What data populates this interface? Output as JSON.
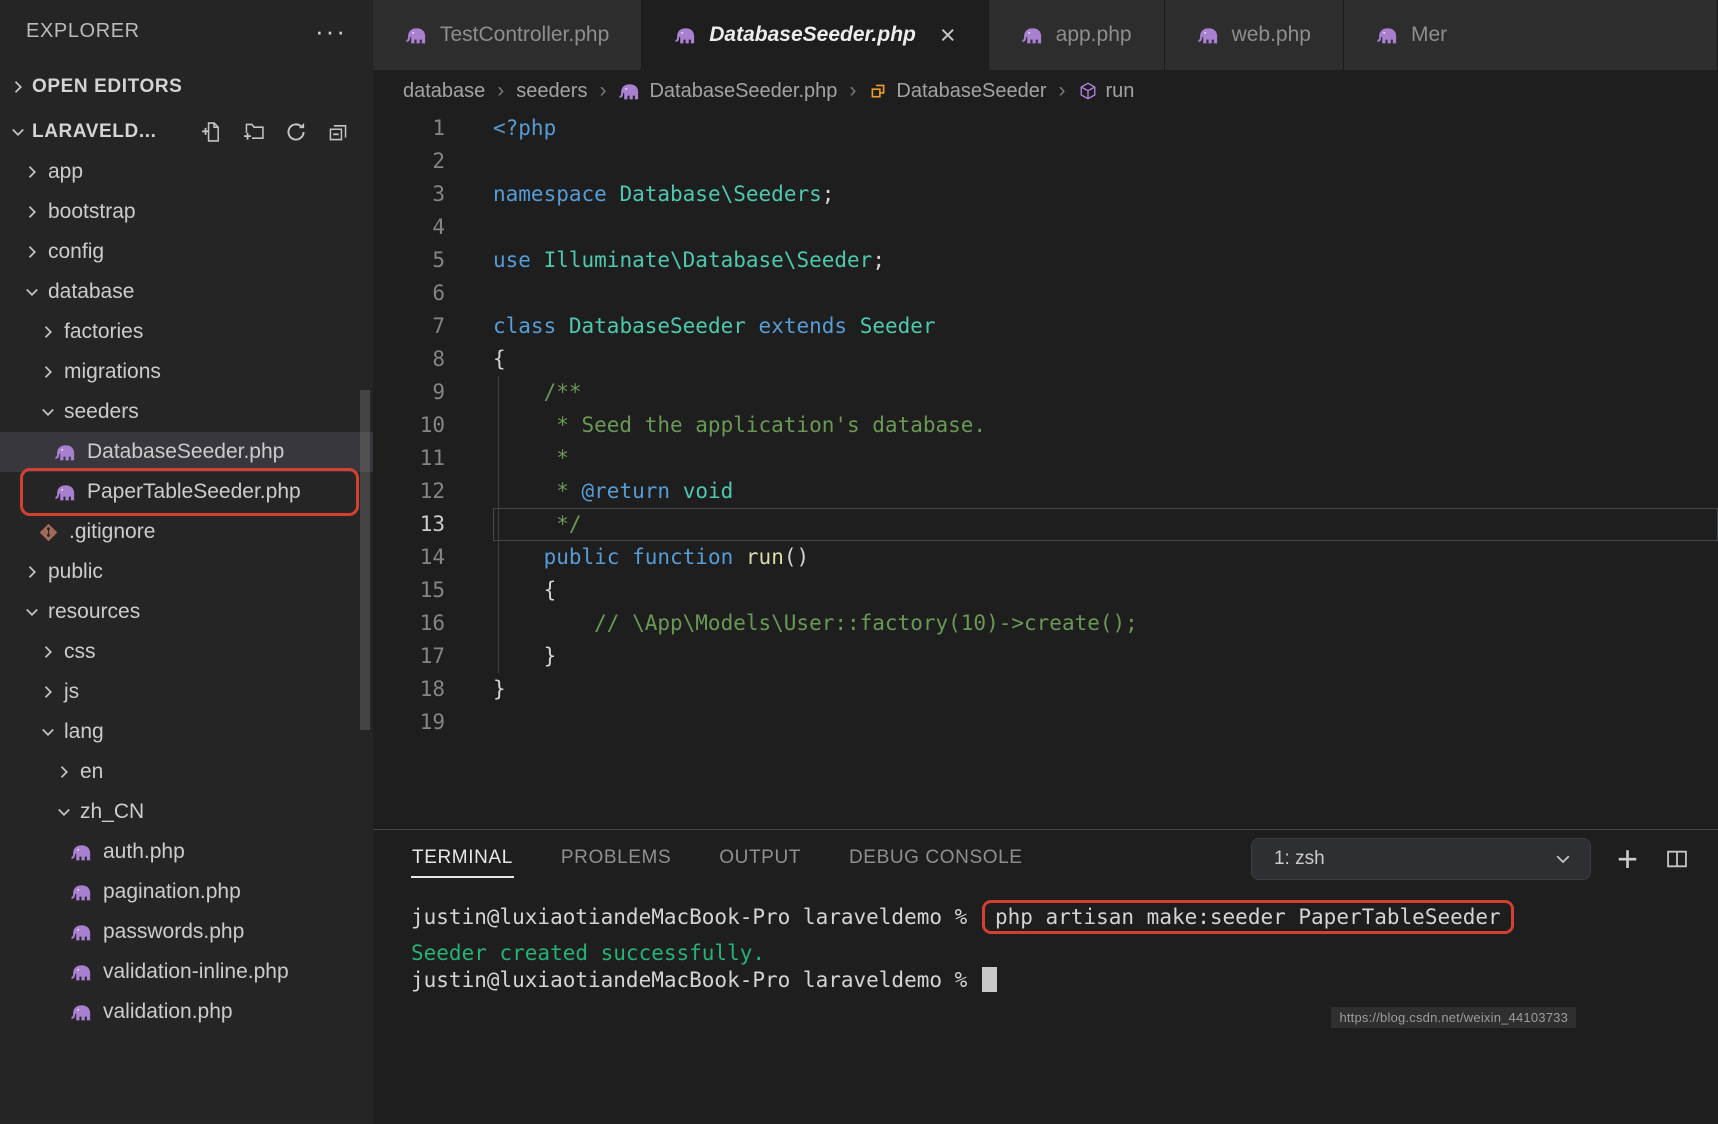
{
  "colors": {
    "annotation_red": "#d3402f",
    "php_icon_purple": "#A97FD0",
    "keyword_blue": "#569cd6",
    "type_teal": "#4ec9b0",
    "comment_green": "#6a9955",
    "function_yellow": "#dcdcaa",
    "terminal_success_green": "#26b277",
    "selection_bg": "#37373d"
  },
  "sidebar": {
    "title": "EXPLORER",
    "more_glyph": "···",
    "open_editors_label": "OPEN EDITORS",
    "workspace_label": "LARAVELD...",
    "workspace_actions": [
      {
        "icon": "new-file-icon"
      },
      {
        "icon": "new-folder-icon"
      },
      {
        "icon": "refresh-icon"
      },
      {
        "icon": "collapse-all-icon"
      }
    ],
    "tree": [
      {
        "label": "app",
        "kind": "folder",
        "expanded": false,
        "indent": 1
      },
      {
        "label": "bootstrap",
        "kind": "folder",
        "expanded": false,
        "indent": 1
      },
      {
        "label": "config",
        "kind": "folder",
        "expanded": false,
        "indent": 1
      },
      {
        "label": "database",
        "kind": "folder",
        "expanded": true,
        "indent": 1
      },
      {
        "label": "factories",
        "kind": "folder",
        "expanded": false,
        "indent": 2
      },
      {
        "label": "migrations",
        "kind": "folder",
        "expanded": false,
        "indent": 2
      },
      {
        "label": "seeders",
        "kind": "folder",
        "expanded": true,
        "indent": 2
      },
      {
        "label": "DatabaseSeeder.php",
        "kind": "php",
        "indent": 3,
        "selected": true
      },
      {
        "label": "PaperTableSeeder.php",
        "kind": "php",
        "indent": 3,
        "annotated": true
      },
      {
        "label": ".gitignore",
        "kind": "git",
        "indent": 2
      },
      {
        "label": "public",
        "kind": "folder",
        "expanded": false,
        "indent": 1
      },
      {
        "label": "resources",
        "kind": "folder",
        "expanded": true,
        "indent": 1
      },
      {
        "label": "css",
        "kind": "folder",
        "expanded": false,
        "indent": 2
      },
      {
        "label": "js",
        "kind": "folder",
        "expanded": false,
        "indent": 2
      },
      {
        "label": "lang",
        "kind": "folder",
        "expanded": true,
        "indent": 2
      },
      {
        "label": "en",
        "kind": "folder",
        "expanded": false,
        "indent": 3
      },
      {
        "label": "zh_CN",
        "kind": "folder",
        "expanded": true,
        "indent": 3
      },
      {
        "label": "auth.php",
        "kind": "php",
        "indent": 4
      },
      {
        "label": "pagination.php",
        "kind": "php",
        "indent": 4
      },
      {
        "label": "passwords.php",
        "kind": "php",
        "indent": 4
      },
      {
        "label": "validation-inline.php",
        "kind": "php",
        "indent": 4
      },
      {
        "label": "validation.php",
        "kind": "php",
        "indent": 4
      }
    ]
  },
  "tabs": [
    {
      "label": "TestController.php",
      "active": false
    },
    {
      "label": "DatabaseSeeder.php",
      "active": true
    },
    {
      "label": "app.php",
      "active": false
    },
    {
      "label": "web.php",
      "active": false
    },
    {
      "label": "Mer",
      "active": false
    }
  ],
  "breadcrumb": [
    {
      "label": "database"
    },
    {
      "label": "seeders"
    },
    {
      "label": "DatabaseSeeder.php",
      "icon": "php-file-icon"
    },
    {
      "label": "DatabaseSeeder",
      "icon": "class-icon"
    },
    {
      "label": "run",
      "icon": "method-icon"
    }
  ],
  "editor": {
    "lines": [
      {
        "n": 1,
        "tokens": [
          {
            "c": "kw",
            "t": "<?php"
          }
        ]
      },
      {
        "n": 2,
        "tokens": []
      },
      {
        "n": 3,
        "tokens": [
          {
            "c": "kw",
            "t": "namespace"
          },
          {
            "c": "pl",
            "t": " "
          },
          {
            "c": "type",
            "t": "Database\\Seeders"
          },
          {
            "c": "pl",
            "t": ";"
          }
        ]
      },
      {
        "n": 4,
        "tokens": []
      },
      {
        "n": 5,
        "tokens": [
          {
            "c": "kw",
            "t": "use"
          },
          {
            "c": "pl",
            "t": " "
          },
          {
            "c": "type",
            "t": "Illuminate\\Database\\Seeder"
          },
          {
            "c": "pl",
            "t": ";"
          }
        ]
      },
      {
        "n": 6,
        "tokens": []
      },
      {
        "n": 7,
        "tokens": [
          {
            "c": "kw",
            "t": "class"
          },
          {
            "c": "pl",
            "t": " "
          },
          {
            "c": "type",
            "t": "DatabaseSeeder"
          },
          {
            "c": "pl",
            "t": " "
          },
          {
            "c": "kw",
            "t": "extends"
          },
          {
            "c": "pl",
            "t": " "
          },
          {
            "c": "type",
            "t": "Seeder"
          }
        ]
      },
      {
        "n": 8,
        "tokens": [
          {
            "c": "pl",
            "t": "{"
          }
        ]
      },
      {
        "n": 9,
        "tokens": [
          {
            "c": "cm",
            "t": "    /**"
          }
        ]
      },
      {
        "n": 10,
        "tokens": [
          {
            "c": "cm",
            "t": "     * Seed the application's database."
          }
        ]
      },
      {
        "n": 11,
        "tokens": [
          {
            "c": "cm",
            "t": "     *"
          }
        ]
      },
      {
        "n": 12,
        "tokens": [
          {
            "c": "cm",
            "t": "     * "
          },
          {
            "c": "kw",
            "t": "@return"
          },
          {
            "c": "cm",
            "t": " "
          },
          {
            "c": "type",
            "t": "void"
          }
        ]
      },
      {
        "n": 13,
        "current": true,
        "tokens": [
          {
            "c": "cm",
            "t": "     */"
          }
        ]
      },
      {
        "n": 14,
        "tokens": [
          {
            "c": "pl",
            "t": "    "
          },
          {
            "c": "kw",
            "t": "public"
          },
          {
            "c": "pl",
            "t": " "
          },
          {
            "c": "kw",
            "t": "function"
          },
          {
            "c": "pl",
            "t": " "
          },
          {
            "c": "fn",
            "t": "run"
          },
          {
            "c": "pl",
            "t": "()"
          }
        ]
      },
      {
        "n": 15,
        "tokens": [
          {
            "c": "pl",
            "t": "    {"
          }
        ]
      },
      {
        "n": 16,
        "tokens": [
          {
            "c": "cm",
            "t": "        // \\App\\Models\\User::factory(10)->create();"
          }
        ]
      },
      {
        "n": 17,
        "tokens": [
          {
            "c": "pl",
            "t": "    }"
          }
        ]
      },
      {
        "n": 18,
        "tokens": [
          {
            "c": "pl",
            "t": "}"
          }
        ]
      },
      {
        "n": 19,
        "tokens": []
      }
    ]
  },
  "terminal": {
    "tabs": [
      {
        "label": "TERMINAL",
        "active": true
      },
      {
        "label": "PROBLEMS",
        "active": false
      },
      {
        "label": "OUTPUT",
        "active": false
      },
      {
        "label": "DEBUG CONSOLE",
        "active": false
      }
    ],
    "shell_select": "1: zsh",
    "new_terminal_glyph": "+",
    "lines": [
      {
        "tokens": [
          {
            "c": "pl",
            "t": "justin@luxiaotiandeMacBook-Pro laraveldemo % "
          },
          {
            "c": "pl",
            "t": "php artisan make:seeder PaperTableSeeder",
            "box": true
          }
        ]
      },
      {
        "tokens": [
          {
            "c": "tgreen",
            "t": "Seeder created successfully."
          }
        ]
      },
      {
        "tokens": [
          {
            "c": "pl",
            "t": "justin@luxiaotiandeMacBook-Pro laraveldemo % "
          },
          {
            "c": "cursor",
            "t": ""
          }
        ]
      }
    ]
  },
  "watermark": "https://blog.csdn.net/weixin_44103733"
}
